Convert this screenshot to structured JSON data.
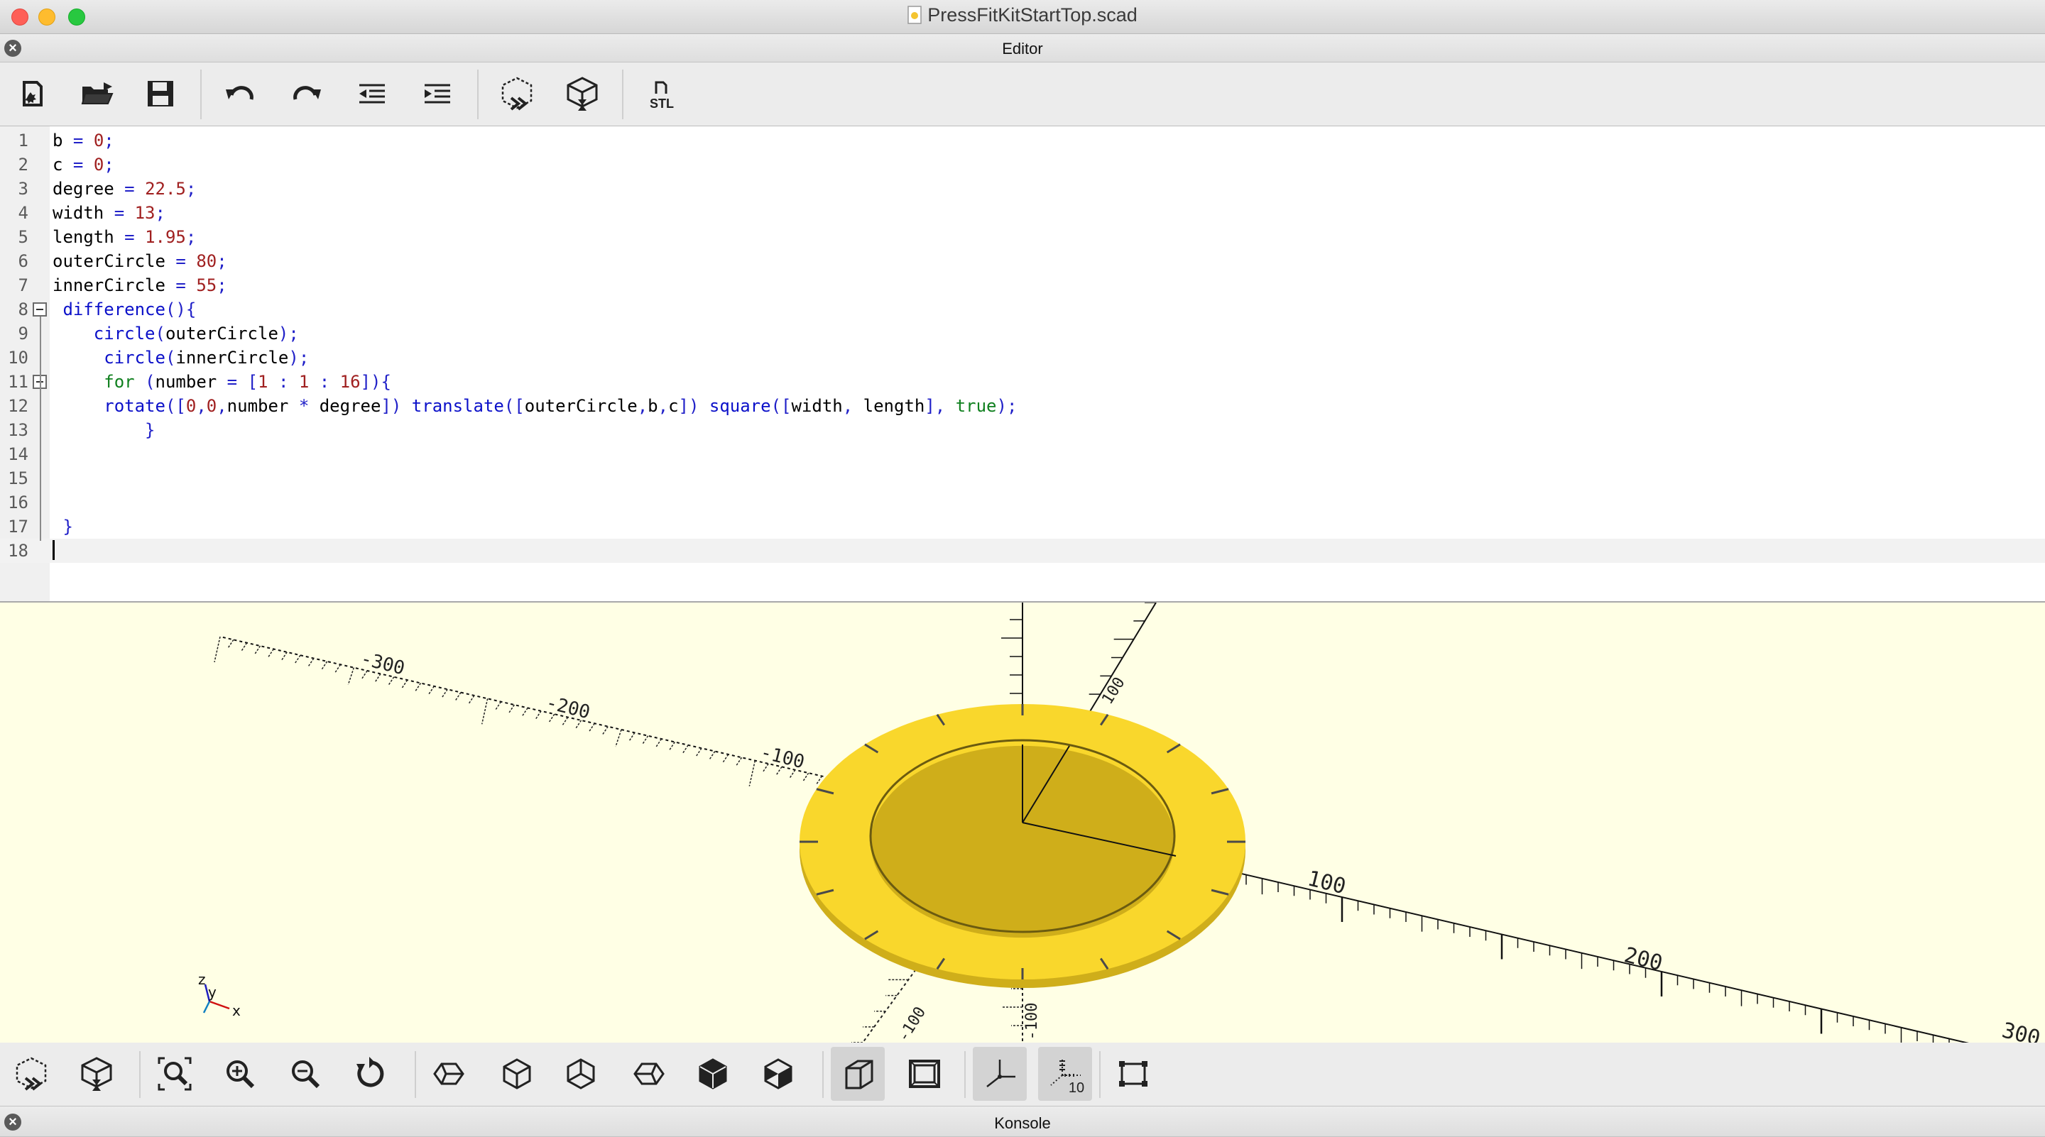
{
  "window": {
    "title": "PressFitKitStartTop.scad"
  },
  "editor_dock": {
    "title": "Editor"
  },
  "console_dock": {
    "title": "Konsole"
  },
  "editor_toolbar": [
    {
      "name": "new-file-icon"
    },
    {
      "name": "open-file-icon"
    },
    {
      "name": "save-file-icon"
    },
    {
      "name": "undo-icon"
    },
    {
      "name": "redo-icon"
    },
    {
      "name": "unindent-icon"
    },
    {
      "name": "indent-icon"
    },
    {
      "name": "preview-icon"
    },
    {
      "name": "render-icon"
    },
    {
      "name": "export-stl-icon",
      "label": "STL"
    }
  ],
  "code": {
    "lines": [
      "b = 0;",
      "c = 0;",
      "degree = 22.5;",
      "width = 13;",
      "length = 1.95;",
      "outerCircle = 80;",
      "innerCircle = 55;",
      " difference(){",
      "    circle(outerCircle);",
      "     circle(innerCircle);",
      "     for (number = [1 : 1 : 16]){",
      "     rotate([0,0,number * degree]) translate([outerCircle,b,c]) square([width, length], true);",
      "         }",
      "",
      "",
      "",
      " }",
      ""
    ],
    "current_line": 18,
    "folded_lines": [
      8,
      11
    ]
  },
  "viewport": {
    "background": "#ffffe5",
    "model_color": "#f9d72c",
    "axis_labels_x": [
      "100",
      "200",
      "300"
    ],
    "axis_labels_neg_x": [
      "-100",
      "-200",
      "-300"
    ],
    "axis_labels_y": [
      "100"
    ],
    "axis_labels_neg_y": [
      "-100"
    ],
    "axis_labels_z": [
      "-100"
    ],
    "gizmo_labels": {
      "x": "x",
      "y": "y",
      "z": "z"
    }
  },
  "view_toolbar": [
    {
      "name": "preview-icon"
    },
    {
      "name": "render-icon"
    },
    {
      "name": "view-all-icon"
    },
    {
      "name": "zoom-in-icon"
    },
    {
      "name": "zoom-out-icon"
    },
    {
      "name": "reset-view-icon"
    },
    {
      "name": "view-right-icon"
    },
    {
      "name": "view-top-icon"
    },
    {
      "name": "view-bottom-icon"
    },
    {
      "name": "view-left-icon"
    },
    {
      "name": "view-front-icon"
    },
    {
      "name": "view-back-icon"
    },
    {
      "name": "perspective-icon",
      "active": true
    },
    {
      "name": "orthogonal-icon"
    },
    {
      "name": "show-axes-icon",
      "active": true
    },
    {
      "name": "show-scale-markers-icon",
      "label": "10",
      "active": true
    },
    {
      "name": "show-edges-icon"
    }
  ]
}
